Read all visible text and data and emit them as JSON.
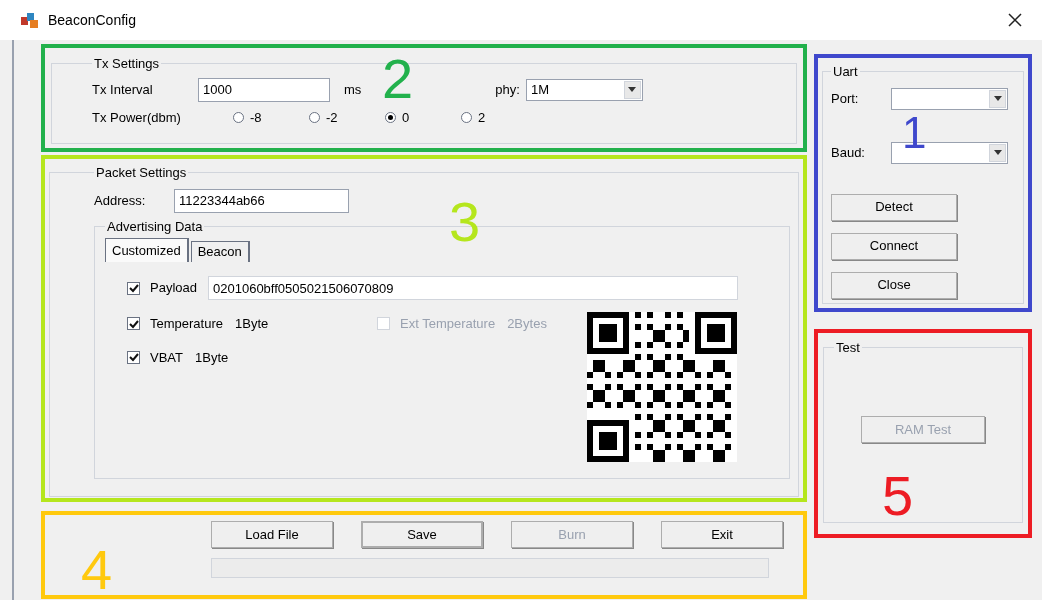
{
  "window": {
    "title": "BeaconConfig"
  },
  "tx_settings": {
    "title": "Tx Settings",
    "annotation": {
      "label": "2",
      "color": "#22b14c"
    },
    "interval_label": "Tx Interval",
    "interval_value": "1000",
    "interval_unit": "ms",
    "phy_label": "phy:",
    "phy_value": "1M",
    "power_label": "Tx Power(dbm)",
    "power_options": [
      {
        "label": "-8",
        "selected": false
      },
      {
        "label": "-2",
        "selected": false
      },
      {
        "label": "0",
        "selected": true
      },
      {
        "label": "2",
        "selected": false
      }
    ]
  },
  "packet_settings": {
    "title": "Packet Settings",
    "annotation": {
      "label": "3",
      "color": "#b5e61d"
    },
    "address_label": "Address:",
    "address_value": "11223344ab66",
    "advertising": {
      "title": "Advertising Data",
      "tabs": [
        {
          "label": "Customized",
          "selected": true
        },
        {
          "label": "Beacon",
          "selected": false
        }
      ],
      "payload": {
        "label": "Payload",
        "checked": true,
        "value": "0201060bff0505021506070809"
      },
      "options": [
        {
          "label": "Temperature",
          "size": "1Byte",
          "checked": true,
          "disabled": false
        },
        {
          "label": "Ext Temperature",
          "size": "2Bytes",
          "checked": false,
          "disabled": true
        },
        {
          "label": "VBAT",
          "size": "1Byte",
          "checked": true,
          "disabled": false
        }
      ]
    }
  },
  "actions": {
    "annotation": {
      "label": "4",
      "color": "#ffc90e"
    },
    "buttons": [
      {
        "label": "Load File",
        "disabled": false,
        "default": false
      },
      {
        "label": "Save",
        "disabled": false,
        "default": true
      },
      {
        "label": "Burn",
        "disabled": true,
        "default": false
      },
      {
        "label": "Exit",
        "disabled": false,
        "default": false
      }
    ],
    "progress": {
      "level": 0
    }
  },
  "uart": {
    "title": "Uart",
    "annotation": {
      "label": "1",
      "color": "#3f48cc"
    },
    "port_label": "Port:",
    "baud_label": "Baud:",
    "buttons": [
      {
        "label": "Detect",
        "disabled": false
      },
      {
        "label": "Connect",
        "disabled": false
      },
      {
        "label": "Close",
        "disabled": false
      }
    ]
  },
  "test": {
    "title": "Test",
    "annotation": {
      "label": "5",
      "color": "#ed1c24"
    },
    "buttons": [
      {
        "label": "RAM Test",
        "disabled": true
      }
    ]
  }
}
